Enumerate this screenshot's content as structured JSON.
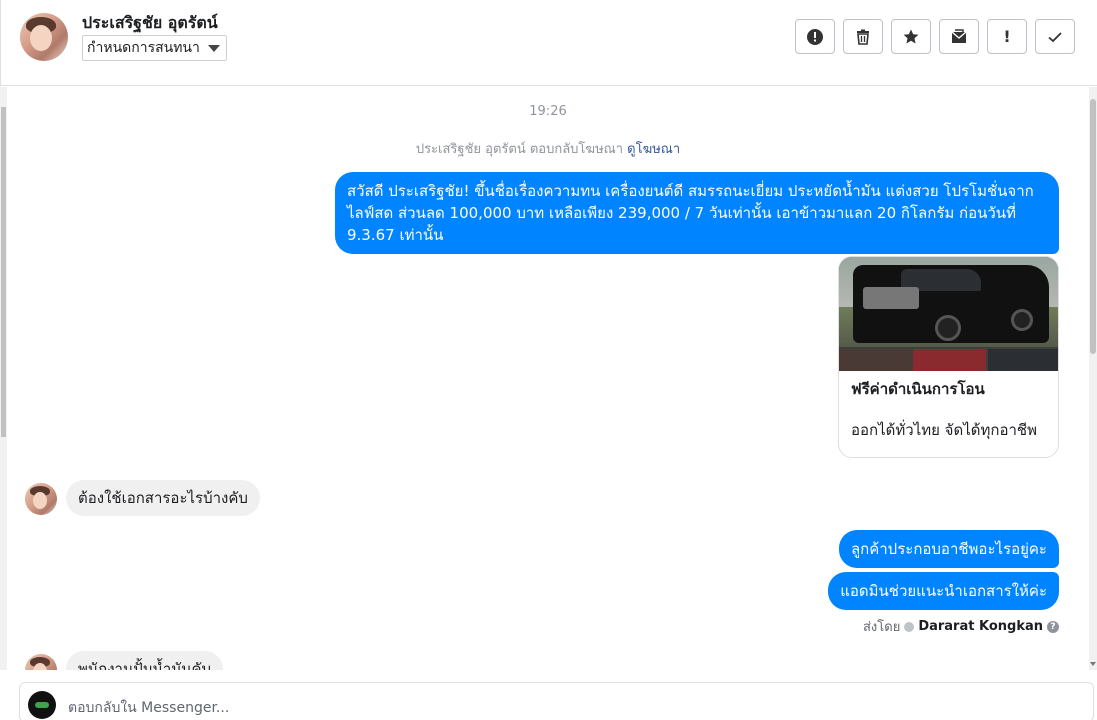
{
  "header": {
    "contact_name": "ประเสริฐชัย อุตรัตน์",
    "assign_label": "กำหนดการสนทนา",
    "toolbar": [
      {
        "name": "spam-button",
        "icon": "alert-circle-icon"
      },
      {
        "name": "delete-button",
        "icon": "trash-icon"
      },
      {
        "name": "star-button",
        "icon": "star-icon"
      },
      {
        "name": "mark-unread-button",
        "icon": "envelope-icon"
      },
      {
        "name": "follow-up-button",
        "icon": "exclamation-icon",
        "glyph": "!"
      },
      {
        "name": "done-button",
        "icon": "check-icon"
      }
    ]
  },
  "chat": {
    "timestamp": "19:26",
    "ad_reply_note": "ประเสริฐชัย อุตรัตน์ ตอบกลับโฆษณา",
    "ad_reply_link": "ดูโฆษณา",
    "messages": [
      {
        "direction": "out",
        "text": "สวัสดี ประเสริฐชัย! ขึ้นชื่อเรื่องความทน เครื่องยนต์ดี สมรรถนะเยี่ยม ประหยัดน้ำมัน แต่งสวย โปรโมชั่นจาก ไลฟ์สด ส่วนลด 100,000 บาท เหลือเพียง 239,000 / 7 วันเท่านั้น เอาข้าวมาแลก 20 กิโลกรัม ก่อนวันที่ 9.3.67 เท่านั้น"
      },
      {
        "direction": "in",
        "text": "ต้องใช้เอกสารอะไรบ้างคับ"
      },
      {
        "direction": "out",
        "text": "ลูกค้าประกอบอาชีพอะไรอยู่คะ"
      },
      {
        "direction": "out",
        "text": "แอดมินช่วยแนะนำเอกสารให้ค่ะ"
      },
      {
        "direction": "in",
        "text": "พนักงานปั้มน้ำมันคับ"
      }
    ],
    "ad_card": {
      "title": "ฟรีค่าดำเนินการโอน",
      "description": "ออกได้ทั่วไทย จัดได้ทุกอาชีพ"
    },
    "sent_by_label": "ส่งโดย",
    "sent_by_name": "Dararat Kongkan"
  },
  "composer": {
    "placeholder": "ตอบกลับใน Messenger..."
  },
  "colors": {
    "outgoing_bubble": "#0084ff",
    "incoming_bubble": "#f1f0f0",
    "link": "#365899"
  }
}
